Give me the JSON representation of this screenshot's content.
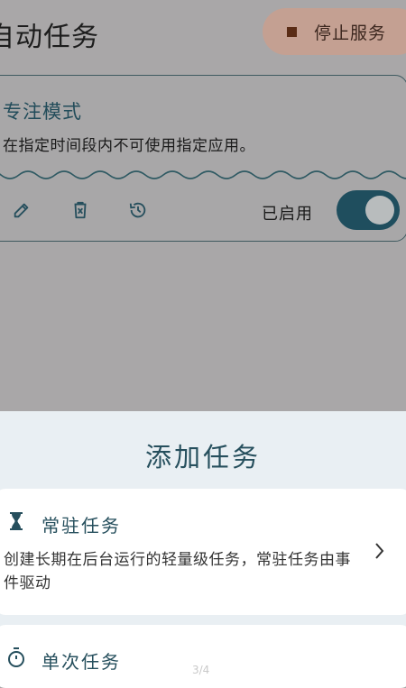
{
  "header": {
    "title": "自动任务",
    "stop_service_label": "停止服务"
  },
  "task_card": {
    "name": "专注模式",
    "description": "在指定时间段内不可使用指定应用。",
    "enabled_label": "已启用",
    "enabled": true,
    "actions": [
      "edit-icon",
      "delete-icon",
      "history-icon"
    ]
  },
  "sheet": {
    "title": "添加任务",
    "options": [
      {
        "icon": "hourglass-icon",
        "title": "常驻任务",
        "description": "创建长期在后台运行的轻量级任务，常驻任务由事件驱动"
      },
      {
        "icon": "timer-icon",
        "title": "单次任务"
      }
    ]
  },
  "page_indicator": "3/4",
  "colors": {
    "accent": "#1f4e5e",
    "title_teal": "#264f5d",
    "stop_button": "#c4a092",
    "sheet_bg": "#e9eff3",
    "scrim": "#a8a7a8"
  }
}
